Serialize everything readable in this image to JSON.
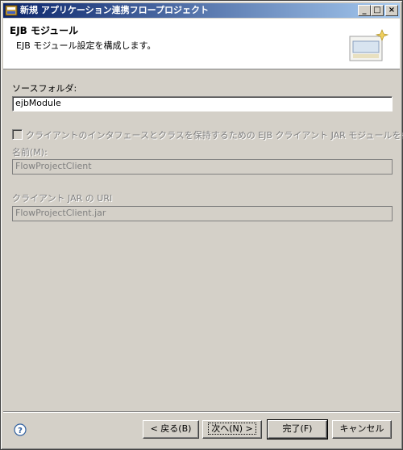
{
  "window": {
    "title": "新規 アプリケーション連携フロープロジェクト"
  },
  "header": {
    "title": "EJB モジュール",
    "description": "EJB モジュール設定を構成します。"
  },
  "form": {
    "source_folder_label": "ソースフォルダ:",
    "source_folder_value": "ejbModule",
    "create_client_checkbox_label": "クライアントのインタフェースとクラスを保持するための EJB クライアント JAR モジュールを作成",
    "create_client_checked": false,
    "name_label": "名前(M):",
    "name_value": "FlowProjectClient",
    "client_uri_label": "クライアント JAR の URI",
    "client_uri_value": "FlowProjectClient.jar"
  },
  "buttons": {
    "back": "< 戻る(B)",
    "next": "次へ(N) >",
    "finish": "完了(F)",
    "cancel": "キャンセル"
  }
}
